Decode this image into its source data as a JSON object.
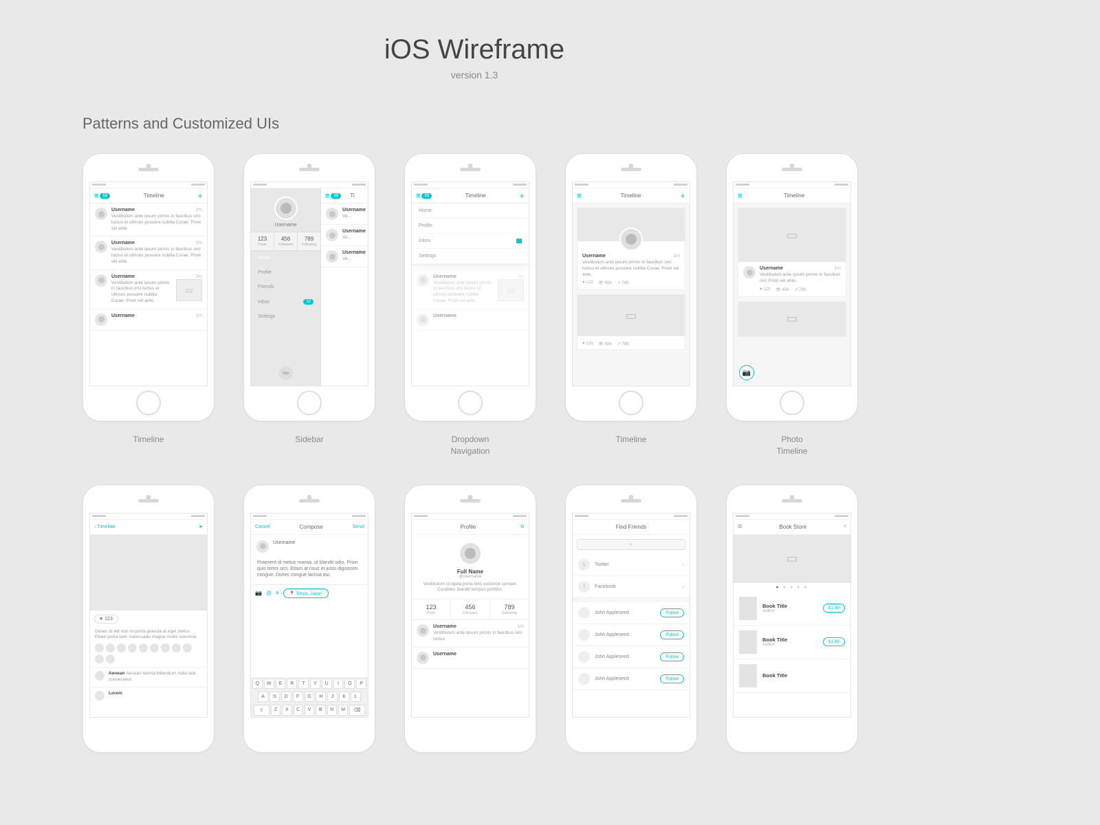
{
  "page": {
    "title": "iOS Wireframe",
    "version": "version 1.3",
    "section": "Patterns and Customized UIs"
  },
  "captions": {
    "timeline": "Timeline",
    "sidebar": "Sidebar",
    "dropdown": "Dropdown\nNavigation",
    "timeline2": "Timeline",
    "photo": "Photo\nTimeline"
  },
  "nav": {
    "timeline": "Timeline",
    "compose": "Compose",
    "profile": "Profile",
    "findfriends": "Find Friends",
    "bookstore": "Book Store",
    "cancel": "Cancel",
    "send": "Send"
  },
  "badge_count": "12",
  "post": {
    "username": "Username",
    "time": "1m",
    "body_long": "Vestibulum ante ipsum primis in faucibus orci luctus et ultrices posuere cubilia Curae; Proin vel ante.",
    "body_short": "Vestibulum ante ipsum primis in faucibus orci Proin vel ante."
  },
  "stats": {
    "likes": "123",
    "views": "456",
    "shares": "789"
  },
  "sidebar": {
    "username": "Username",
    "posts": {
      "n": "123",
      "l": "Posts"
    },
    "followers": {
      "n": "456",
      "l": "Followers"
    },
    "following": {
      "n": "789",
      "l": "Following"
    },
    "items": {
      "home": "Home",
      "profile": "Profile",
      "friends": "Friends",
      "inbox": "Inbox",
      "settings": "Settings"
    },
    "sign": "Sign"
  },
  "dropdown": {
    "home": "Home",
    "profile": "Profile",
    "inbox": "Inbox",
    "settings": "Settings",
    "badge": "12"
  },
  "detail": {
    "back": "Timeline",
    "likes": "123",
    "comment1": "Donec id elit non mi porta gravida at eget metus. Etiam porta sem malesuada magna mollis euismod.",
    "commenter1": "Donec",
    "comment2": "Aenean lacinia bibendum nulla sed consectetur.",
    "commenter2": "Aenean"
  },
  "compose": {
    "username": "Username",
    "body": "Praesent id metus massa, ut blandit odio. Proin quis tortor orci. Etiam at risus et justo dignissim congue. Donec congue lacinia dui.",
    "location": "Tokyo, Japan",
    "keys_r1": [
      "Q",
      "W",
      "E",
      "R",
      "T",
      "Y",
      "U",
      "I",
      "O",
      "P"
    ],
    "keys_r2": [
      "A",
      "S",
      "D",
      "F",
      "G",
      "H",
      "J",
      "K",
      "L"
    ],
    "keys_r3": [
      "Z",
      "X",
      "C",
      "V",
      "B",
      "N",
      "M"
    ]
  },
  "profile": {
    "fullname": "Full Name",
    "handle": "@username",
    "bio": "Vestibulum id ligula porta felis euismod semper. Curabitur blandit tempus porttitor.",
    "posts": {
      "n": "123",
      "l": "Posts"
    },
    "followers": {
      "n": "456",
      "l": "Followers"
    },
    "following": {
      "n": "789",
      "l": "Following"
    },
    "item_user": "Username",
    "item_body": "Vestibulum ante ipsum primis in faucibus orci luctus."
  },
  "friends": {
    "twitter": "Twitter",
    "facebook": "Facebook",
    "name": "John Appleseed",
    "follow": "Follow"
  },
  "store": {
    "book": "Book Title",
    "author": "Author",
    "price": "$1.99"
  }
}
